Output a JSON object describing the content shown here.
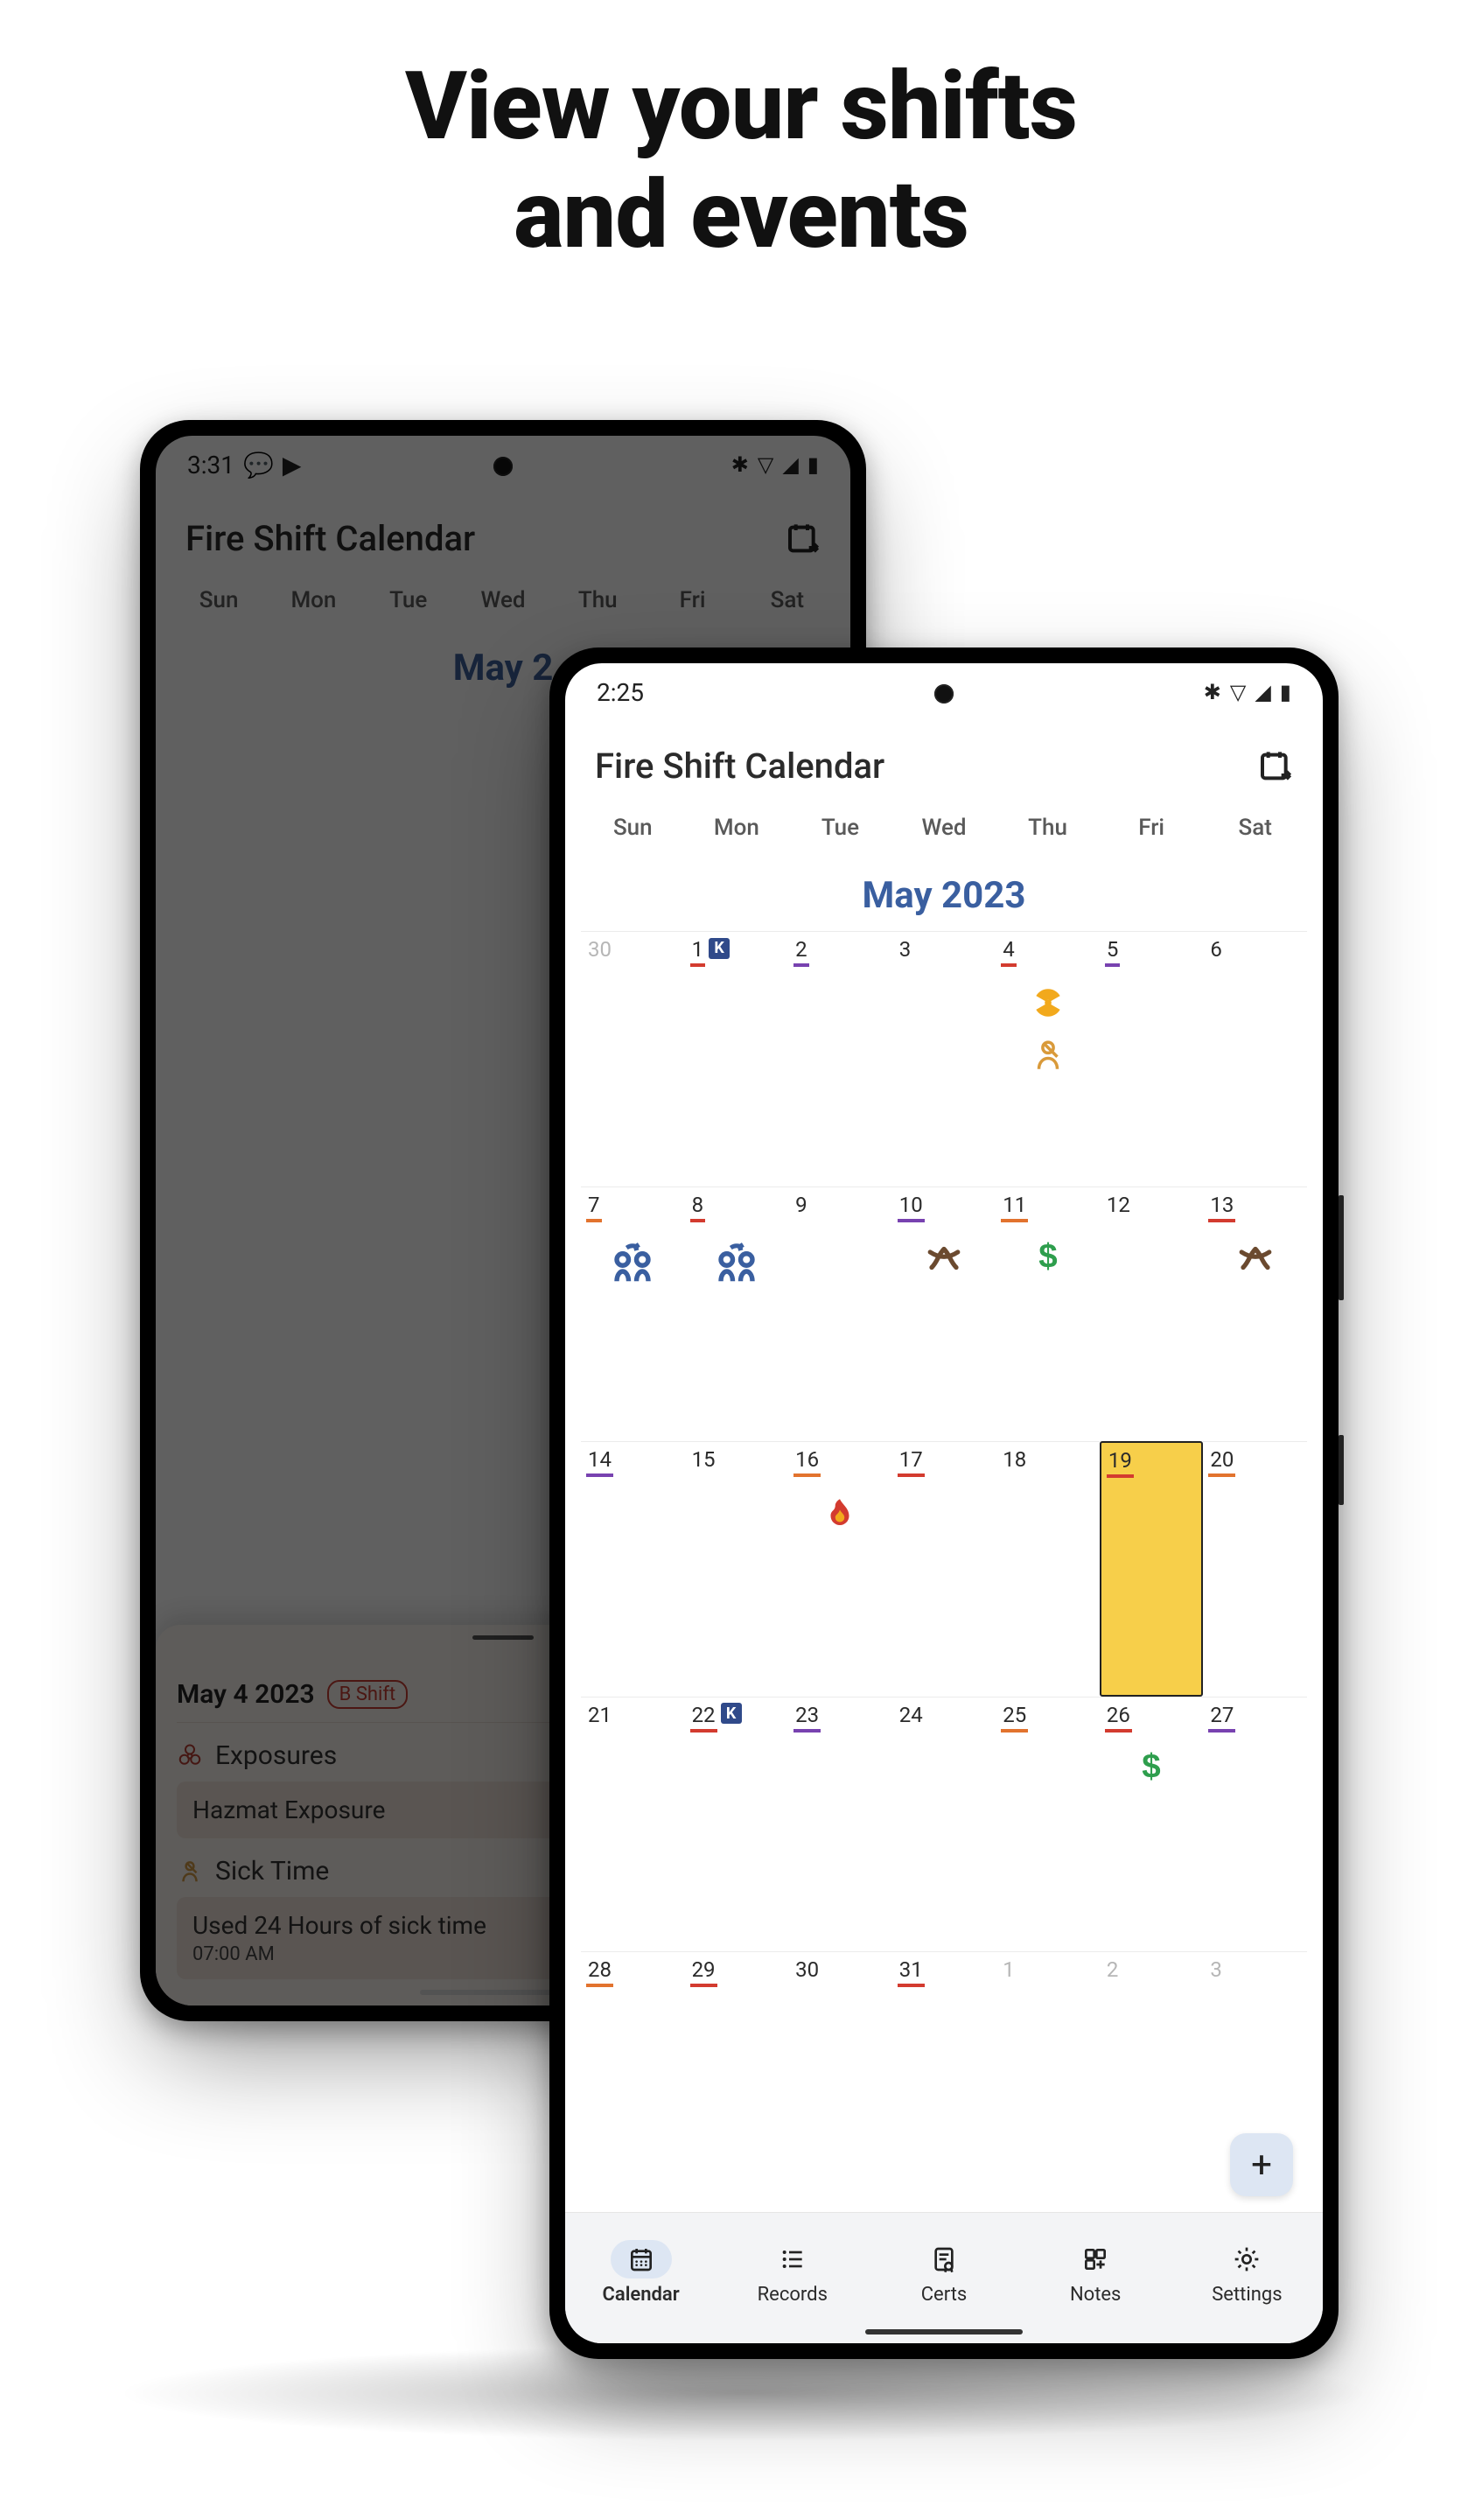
{
  "headline_line1": "View your shifts",
  "headline_line2": "and events",
  "shift_colors": {
    "red": "#d33b2f",
    "purple": "#7842b0",
    "orange": "#e2732e"
  },
  "back_phone": {
    "status_time": "3:31",
    "app_title": "Fire Shift Calendar",
    "weekdays": [
      "Sun",
      "Mon",
      "Tue",
      "Wed",
      "Thu",
      "Fri",
      "Sat"
    ],
    "month": "May 2",
    "sheet": {
      "date": "May 4 2023",
      "chip": "B Shift",
      "exposures_label": "Exposures",
      "exposures_body": "Hazmat Exposure",
      "sick_label": "Sick Time",
      "sick_body": "Used 24 Hours of sick time",
      "sick_time": "07:00 AM"
    }
  },
  "front_phone": {
    "status_time": "2:25",
    "app_title": "Fire Shift Calendar",
    "weekdays": [
      "Sun",
      "Mon",
      "Tue",
      "Wed",
      "Thu",
      "Fri",
      "Sat"
    ],
    "month": "May 2023",
    "today": 19,
    "days": [
      {
        "n": 30,
        "other": true
      },
      {
        "n": 1,
        "u": "red",
        "k": true
      },
      {
        "n": 2,
        "u": "purple"
      },
      {
        "n": 3
      },
      {
        "n": 4,
        "u": "red",
        "icons": [
          "radiation",
          "person-sick"
        ]
      },
      {
        "n": 5,
        "u": "purple"
      },
      {
        "n": 6
      },
      {
        "n": 7,
        "u": "orange",
        "icons": [
          "trade"
        ]
      },
      {
        "n": 8,
        "u": "red",
        "icons": [
          "trade"
        ]
      },
      {
        "n": 9
      },
      {
        "n": 10,
        "u": "purple",
        "icons": [
          "knot"
        ]
      },
      {
        "n": 11,
        "u": "orange",
        "icons": [
          "dollar"
        ]
      },
      {
        "n": 12
      },
      {
        "n": 13,
        "u": "red",
        "icons": [
          "knot"
        ]
      },
      {
        "n": 14,
        "u": "purple"
      },
      {
        "n": 15
      },
      {
        "n": 16,
        "u": "orange",
        "icons": [
          "fire"
        ]
      },
      {
        "n": 17,
        "u": "red"
      },
      {
        "n": 18
      },
      {
        "n": 19,
        "u": "red",
        "today": true
      },
      {
        "n": 20,
        "u": "orange"
      },
      {
        "n": 21
      },
      {
        "n": 22,
        "u": "red",
        "k": true
      },
      {
        "n": 23,
        "u": "purple"
      },
      {
        "n": 24
      },
      {
        "n": 25,
        "u": "orange"
      },
      {
        "n": 26,
        "u": "red",
        "icons": [
          "dollar"
        ]
      },
      {
        "n": 27,
        "u": "purple"
      },
      {
        "n": 28,
        "u": "orange"
      },
      {
        "n": 29,
        "u": "red"
      },
      {
        "n": 30
      },
      {
        "n": 31,
        "u": "red"
      },
      {
        "n": 1,
        "other": true
      },
      {
        "n": 2,
        "other": true
      },
      {
        "n": 3,
        "other": true
      }
    ],
    "nav": {
      "calendar": "Calendar",
      "records": "Records",
      "certs": "Certs",
      "notes": "Notes",
      "settings": "Settings"
    }
  }
}
